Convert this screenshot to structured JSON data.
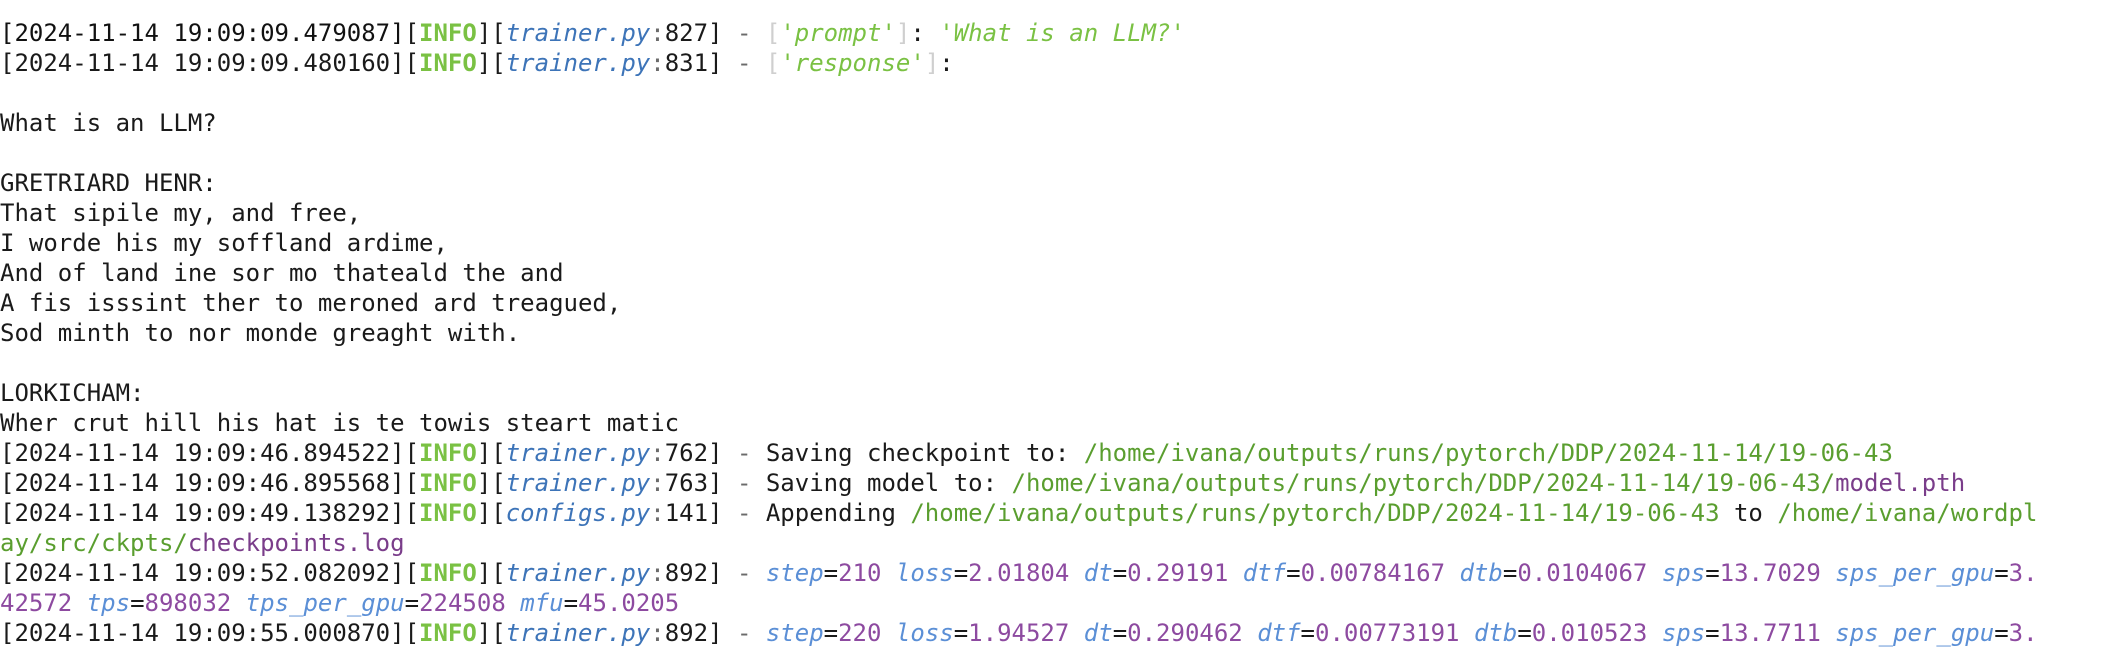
{
  "colors": {
    "info": "#7ac143",
    "file": "#3d74b8",
    "path": "#5a9e2f",
    "metric_key": "#5b8fd6",
    "metric_value": "#8d4aa0"
  },
  "log": {
    "top_fragment": "  ...  _  ...  ",
    "lines": {
      "l1": {
        "ts": "[2024-11-14 19:09:09.479087]",
        "level": "INFO",
        "file": "trainer.py",
        "lineno": "827",
        "key": "'prompt'",
        "value": "'What is an LLM?'"
      },
      "l2": {
        "ts": "[2024-11-14 19:09:09.480160]",
        "level": "INFO",
        "file": "trainer.py",
        "lineno": "831",
        "key": "'response'"
      }
    },
    "response_text": {
      "t1": "What is an LLM?",
      "t2": "GRETRIARD HENR:",
      "t3": "That sipile my, and free,",
      "t4": "I worde his my soffland ardime,",
      "t5": "And of land ine sor mo thateald the and",
      "t6": "A fis isssint ther to meroned ard treagued,",
      "t7": "Sod minth to nor monde greaght with.",
      "t8": "LORKICHAM:",
      "t9": "Wher crut hill his hat is te towis steart matic"
    },
    "save_ckpt": {
      "ts": "[2024-11-14 19:09:46.894522]",
      "level": "INFO",
      "file": "trainer.py",
      "lineno": "762",
      "msg": "Saving checkpoint to: ",
      "path": "/home/ivana/outputs/runs/pytorch/DDP/2024-11-14/19-06-43"
    },
    "save_model": {
      "ts": "[2024-11-14 19:09:46.895568]",
      "level": "INFO",
      "file": "trainer.py",
      "lineno": "763",
      "msg": "Saving model to: ",
      "path": "/home/ivana/outputs/runs/pytorch/DDP/2024-11-14/19-06-43/",
      "filename": "model.pth"
    },
    "append": {
      "ts": "[2024-11-14 19:09:49.138292]",
      "level": "INFO",
      "file": "configs.py",
      "lineno": "141",
      "msg": "Appending ",
      "path": "/home/ivana/outputs/runs/pytorch/DDP/2024-11-14/19-06-43",
      "to": " to ",
      "dest_path": "/home/ivana/wordpl",
      "dest_path_cont": "ay/src/ckpts/",
      "dest_file": "checkpoints.log"
    },
    "step210": {
      "ts": "[2024-11-14 19:09:52.082092]",
      "level": "INFO",
      "file": "trainer.py",
      "lineno": "892",
      "step": "210",
      "loss": "2.01804",
      "dt": "0.29191",
      "dtf": "0.00784167",
      "dtb": "0.0104067",
      "sps": "13.7029",
      "sps_per_gpu": "3.",
      "sps_per_gpu_cont": "42572",
      "tps": "898032",
      "tps_per_gpu": "224508",
      "mfu": "45.0205"
    },
    "step220": {
      "ts": "[2024-11-14 19:09:55.000870]",
      "level": "INFO",
      "file": "trainer.py",
      "lineno": "892",
      "step": "220",
      "loss": "1.94527",
      "dt": "0.290462",
      "dtf": "0.00773191",
      "dtb": "0.010523",
      "sps": "13.7711",
      "sps_per_gpu": "3."
    },
    "labels": {
      "step": "step",
      "loss": "loss",
      "dt": "dt",
      "dtf": "dtf",
      "dtb": "dtb",
      "sps": "sps",
      "sps_per_gpu": "sps_per_gpu",
      "tps": "tps",
      "tps_per_gpu": "tps_per_gpu",
      "mfu": "mfu"
    }
  }
}
